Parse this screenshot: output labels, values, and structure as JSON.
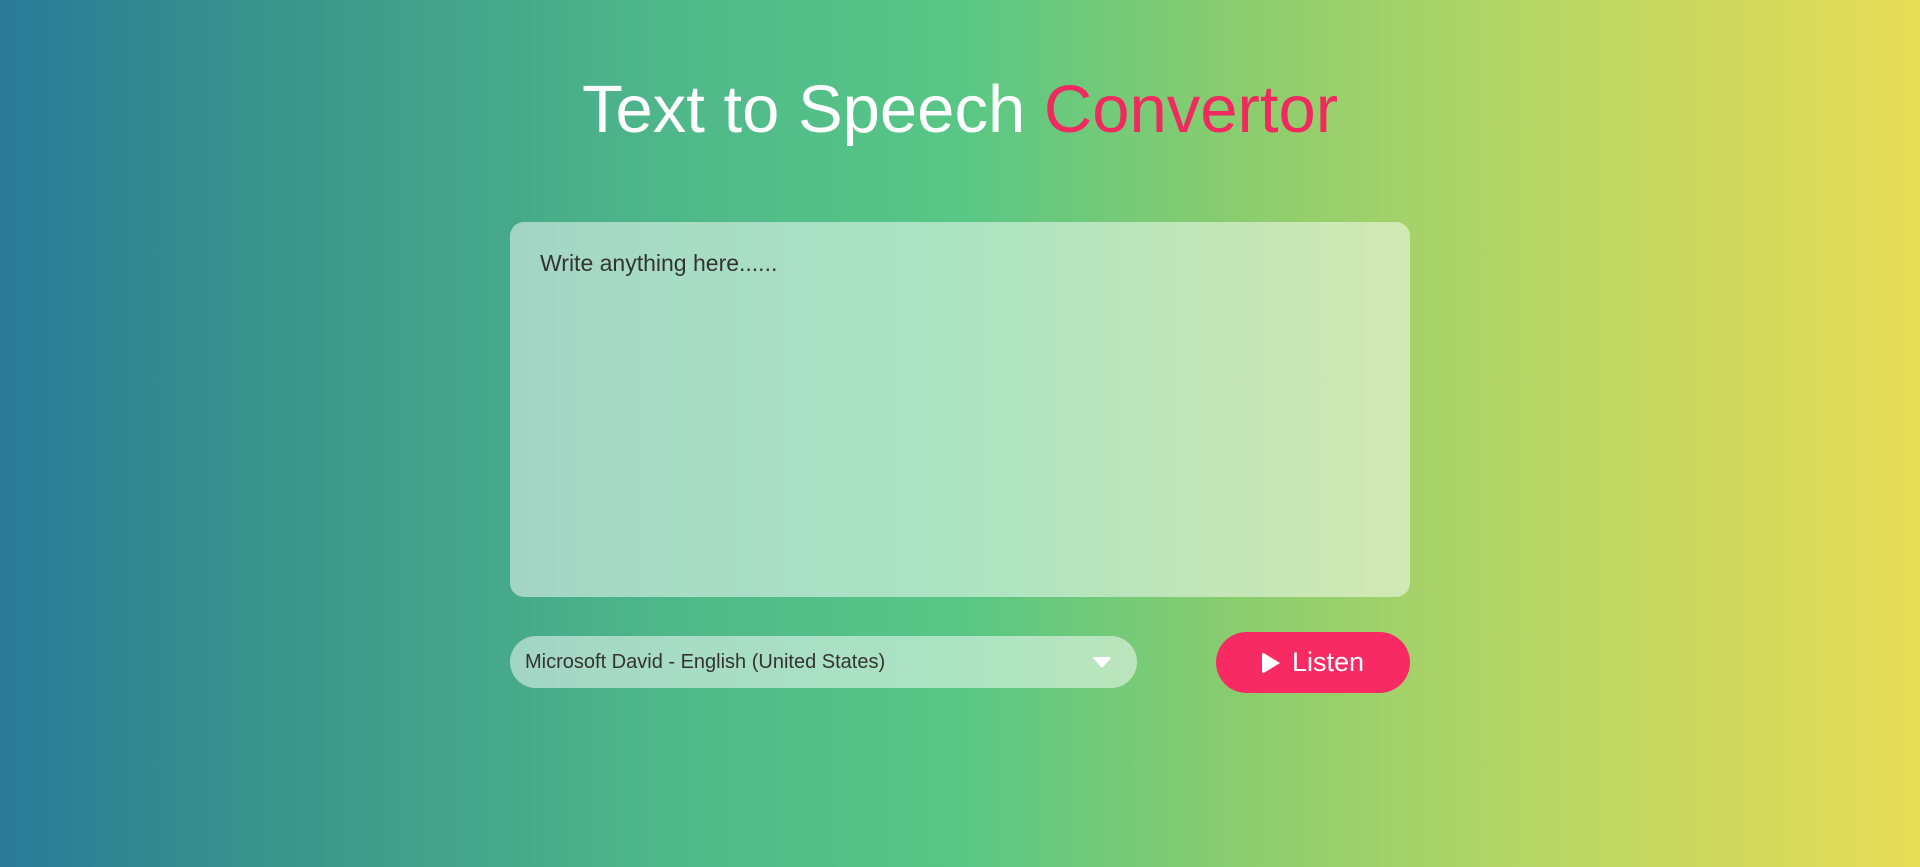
{
  "header": {
    "title_main": "Text to Speech",
    "title_accent": "Convertor",
    "accent_color": "#f0295e"
  },
  "editor": {
    "placeholder": "Write anything here......"
  },
  "voice_select": {
    "selected": "Microsoft David - English (United States)",
    "icon": "chevron-down-icon"
  },
  "listen_button": {
    "label": "Listen",
    "icon": "play-icon",
    "color": "#f72a63"
  }
}
